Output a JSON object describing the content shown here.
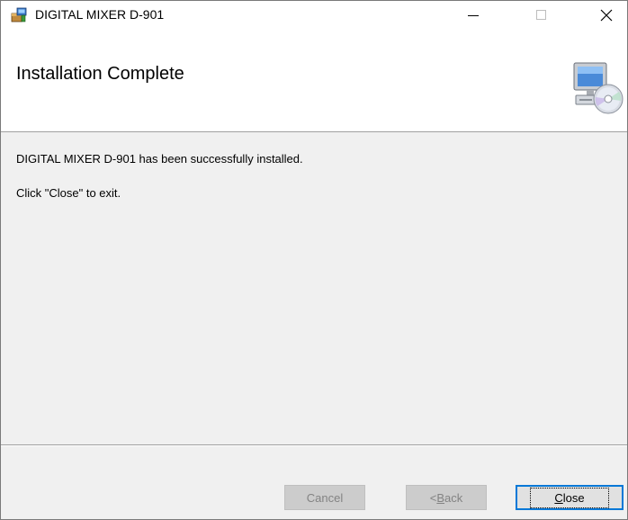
{
  "window": {
    "title": "DIGITAL MIXER D-901",
    "icon": "installer-package-icon",
    "controls": [
      "minimize-icon",
      "maximize-icon",
      "close-icon"
    ]
  },
  "banner": {
    "title": "Installation Complete",
    "icon": "computer-cd-icon"
  },
  "content": {
    "message1": "DIGITAL MIXER D-901 has been successfully installed.",
    "message2": "Click \"Close\" to exit."
  },
  "buttons": {
    "cancel_label": "Cancel",
    "back_prefix": "< ",
    "back_accel": "B",
    "back_rest": "ack",
    "close_accel": "C",
    "close_rest": "lose"
  },
  "colors": {
    "accent": "#0078d7",
    "window_bg": "#f0f0f0",
    "banner_bg": "#ffffff"
  }
}
